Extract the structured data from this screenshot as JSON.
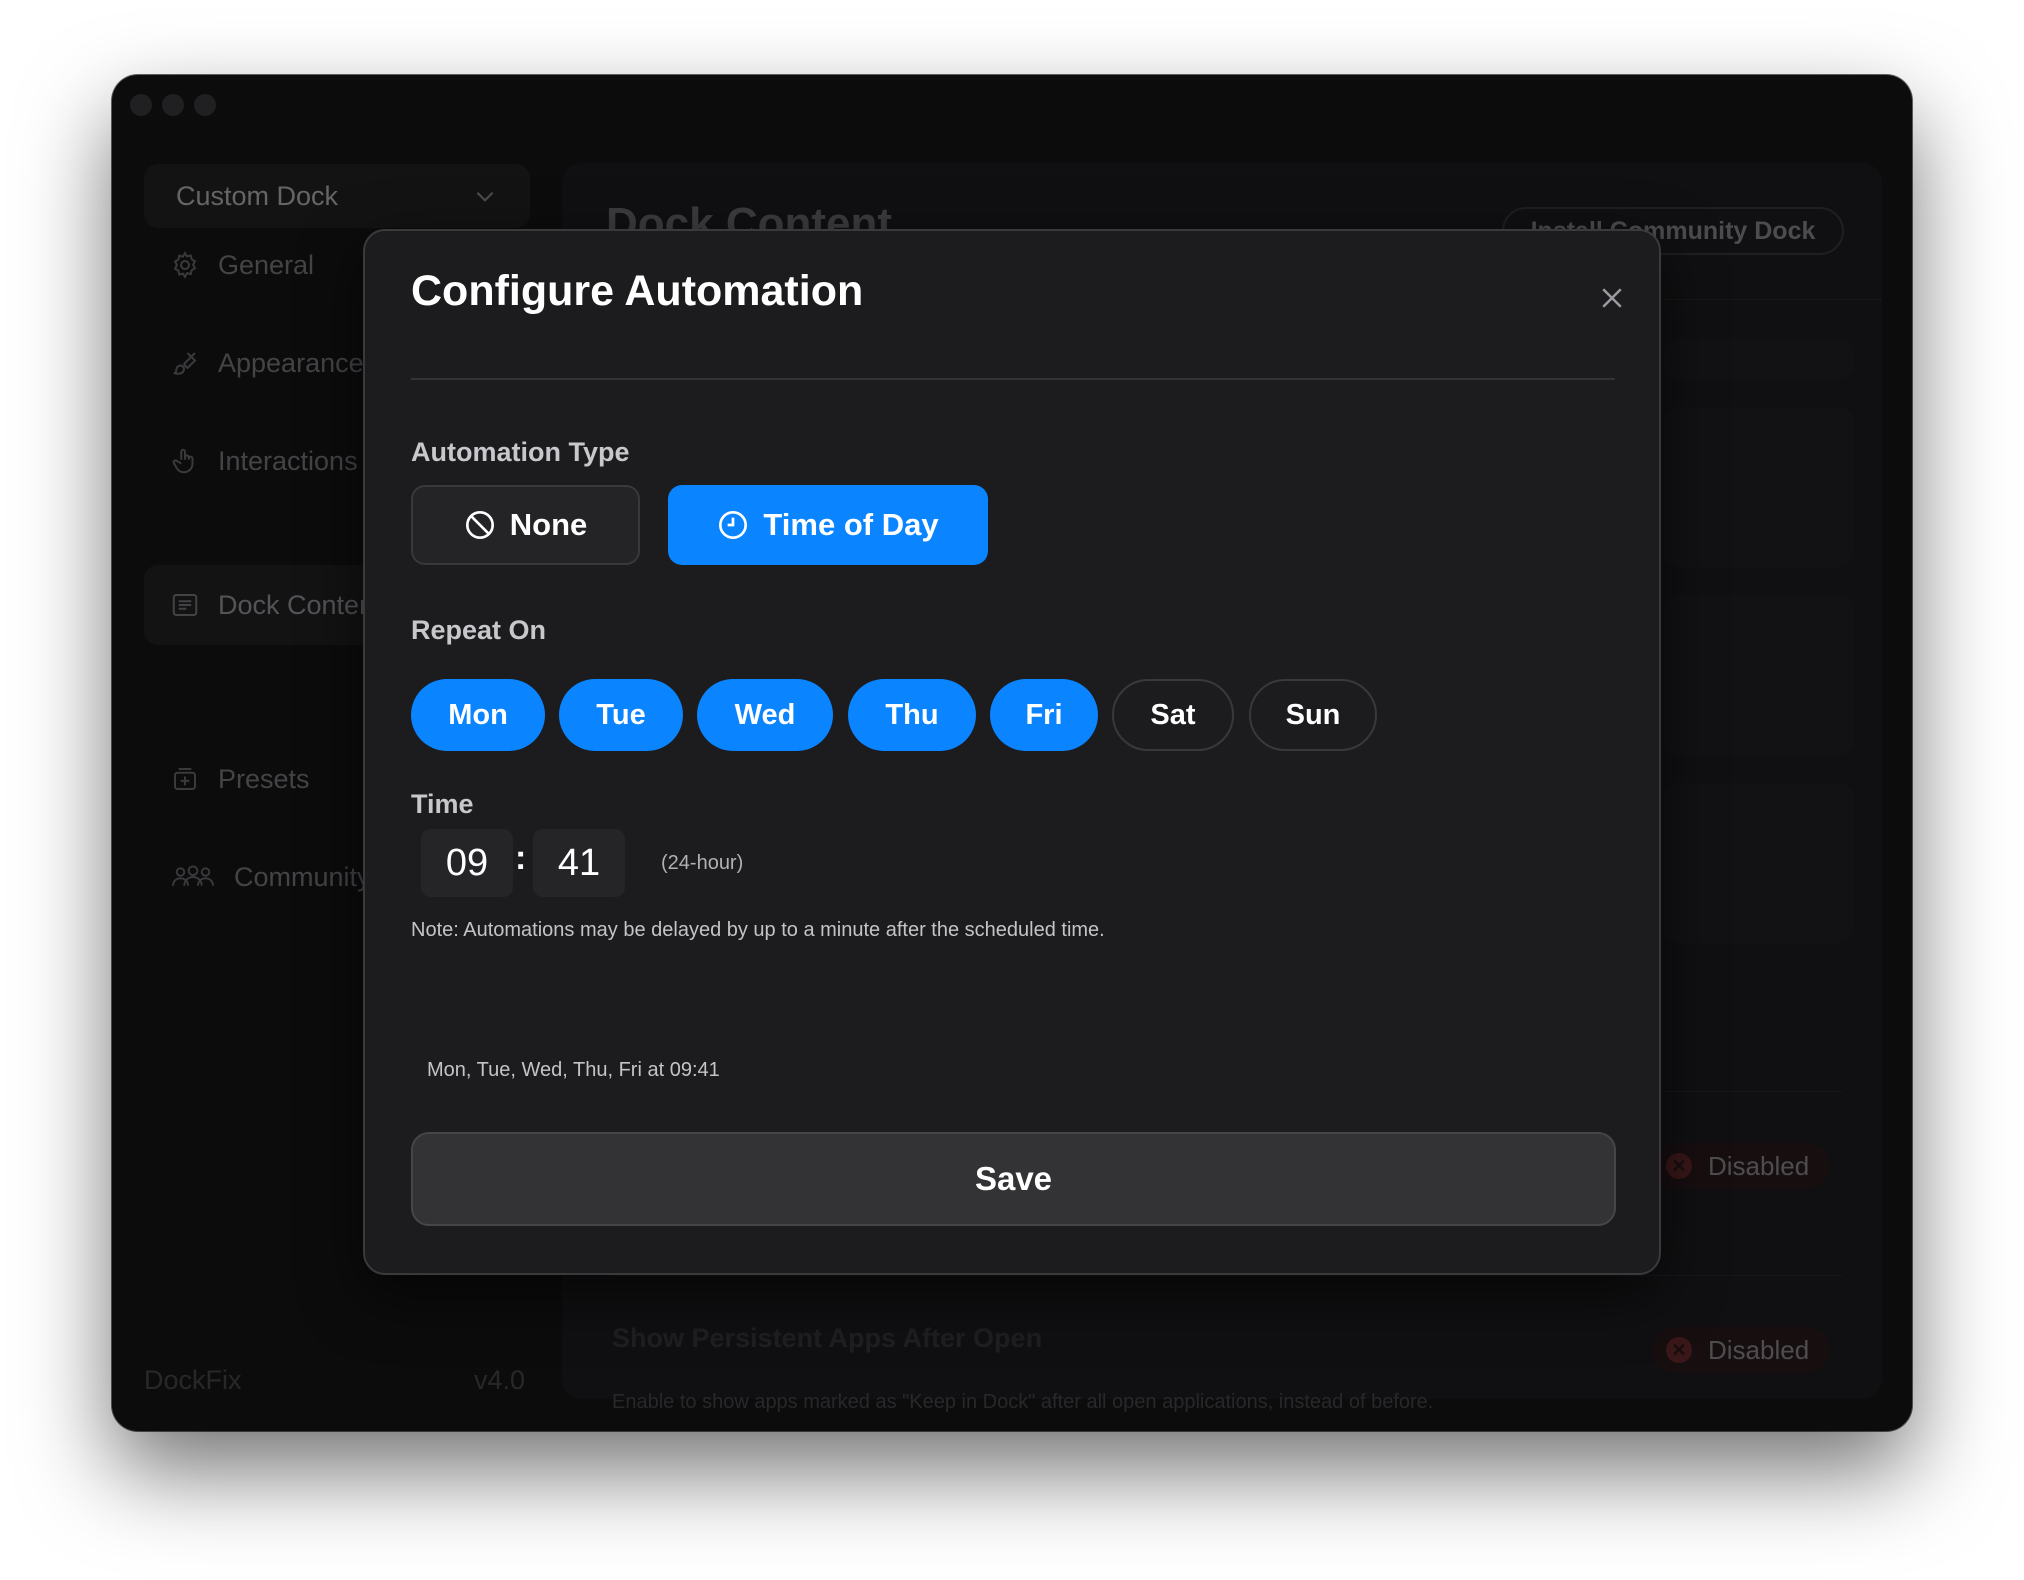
{
  "sidebar": {
    "dock_select": "Custom Dock",
    "items": [
      {
        "label": "General",
        "icon": "gear-icon"
      },
      {
        "label": "Appearance",
        "icon": "brush-icon"
      },
      {
        "label": "Interactions",
        "icon": "hand-icon"
      },
      {
        "label": "Dock Content",
        "icon": "list-icon",
        "active": true
      },
      {
        "label": "Presets",
        "icon": "preset-icon"
      },
      {
        "label": "Community",
        "icon": "people-icon"
      }
    ],
    "app_name": "DockFix",
    "version": "v4.0"
  },
  "main": {
    "title": "Dock Content",
    "install_button": "Install Community Dock",
    "rows": [
      {
        "title": "",
        "status": "Disabled"
      },
      {
        "title": "Show Persistent Apps After Open",
        "description": "Enable to show apps marked as \"Keep in Dock\" after all open applications, instead of before.",
        "status": "Disabled"
      }
    ]
  },
  "dialog": {
    "title": "Configure Automation",
    "type_label": "Automation Type",
    "types": [
      {
        "label": "None",
        "icon": "prohibited-icon",
        "selected": false
      },
      {
        "label": "Time of Day",
        "icon": "clock-icon",
        "selected": true
      }
    ],
    "repeat_label": "Repeat On",
    "days": [
      {
        "label": "Mon",
        "selected": true
      },
      {
        "label": "Tue",
        "selected": true
      },
      {
        "label": "Wed",
        "selected": true
      },
      {
        "label": "Thu",
        "selected": true
      },
      {
        "label": "Fri",
        "selected": true
      },
      {
        "label": "Sat",
        "selected": false
      },
      {
        "label": "Sun",
        "selected": false
      }
    ],
    "time_label": "Time",
    "hour": "09",
    "minute": "41",
    "time_separator": ":",
    "time_hint": "(24-hour)",
    "note": "Note: Automations may be delayed by up to a minute after the scheduled time.",
    "summary": "Mon, Tue, Wed, Thu, Fri at 09:41",
    "save_label": "Save"
  },
  "colors": {
    "accent": "#0a84ff",
    "window_bg": "#161618",
    "dialog_bg": "#1c1c1e",
    "disabled_badge": "#6b2a2d"
  }
}
